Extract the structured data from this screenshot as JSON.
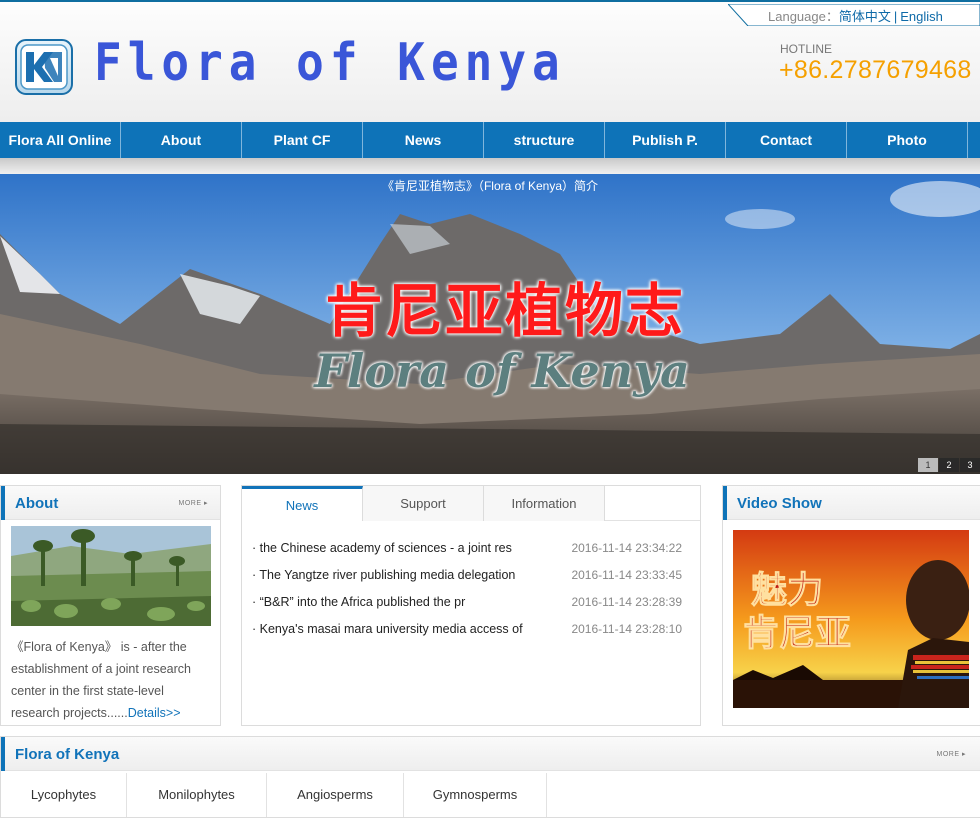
{
  "header": {
    "language_label": "Language：",
    "lang_chinese": "简体中文",
    "lang_separator": "|",
    "lang_english": "English",
    "logo_mark_text": "KK",
    "site_title": "Flora of Kenya",
    "hotline_label": "HOTLINE",
    "hotline_number": "+86.2787679468"
  },
  "nav": {
    "items": [
      {
        "label": "Flora All Online"
      },
      {
        "label": "About"
      },
      {
        "label": "Plant CF"
      },
      {
        "label": "News"
      },
      {
        "label": "structure"
      },
      {
        "label": "Publish P."
      },
      {
        "label": "Contact"
      },
      {
        "label": "Photo"
      }
    ]
  },
  "banner": {
    "caption": "《肯尼亚植物志》（Flora of Kenya）简介",
    "title_cn": "肯尼亚植物志",
    "title_en": "Flora of Kenya",
    "slides": [
      "1",
      "2",
      "3"
    ],
    "active_slide": 1
  },
  "about": {
    "title": "About",
    "more": "MORE",
    "text": "《Flora of Kenya》 is - after the establishment of a joint research center in the first state-level research projects......",
    "details_link": "Details>>"
  },
  "news": {
    "tabs": [
      "News",
      "Support",
      "Information"
    ],
    "active_tab": 0,
    "items": [
      {
        "title": "· the Chinese academy of sciences - a joint res",
        "date": "2016-11-14 23:34:22"
      },
      {
        "title": "· The Yangtze river publishing media delegation",
        "date": "2016-11-14 23:33:45"
      },
      {
        "title": "· “B&R” into the Africa published the pr",
        "date": "2016-11-14 23:28:39"
      },
      {
        "title": "· Kenya's masai mara university media access of",
        "date": "2016-11-14 23:28:10"
      }
    ]
  },
  "video": {
    "title": "Video Show",
    "image_text_line1": "魅力",
    "image_text_line2": "肯尼亚"
  },
  "flora": {
    "title": "Flora of Kenya",
    "more": "MORE",
    "categories": [
      "Lycophytes",
      "Monilophytes",
      "Angiosperms",
      "Gymnosperms"
    ]
  },
  "colors": {
    "brand_blue": "#0e73b8",
    "hotline_orange": "#f5a000",
    "banner_title_red": "#ff1a1a"
  }
}
